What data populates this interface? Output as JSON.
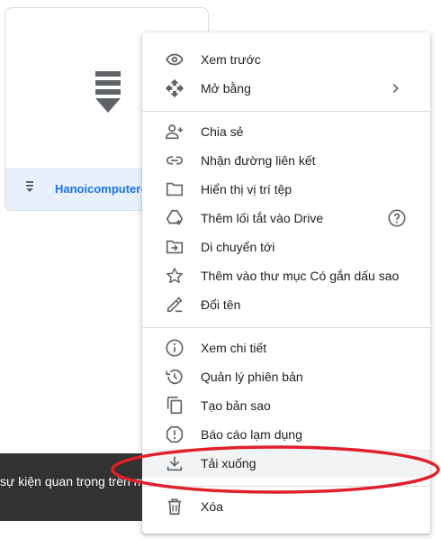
{
  "file": {
    "name": "Hanoicomputer-A"
  },
  "snackbar": {
    "text": "sự kiện quan trọng trên m"
  },
  "menu": {
    "preview": "Xem trước",
    "open_with": "Mở bằng",
    "share": "Chia sẻ",
    "get_link": "Nhận đường liên kết",
    "show_location": "Hiển thị vị trí tệp",
    "add_shortcut": "Thêm lối tắt vào Drive",
    "move_to": "Di chuyển tới",
    "add_starred": "Thêm vào thư mục Có gắn dấu sao",
    "rename": "Đổi tên",
    "view_details": "Xem chi tiết",
    "manage_versions": "Quản lý phiên bản",
    "make_copy": "Tạo bản sao",
    "report_abuse": "Báo cáo lạm dụng",
    "download": "Tải xuống",
    "delete": "Xóa"
  },
  "colors": {
    "icon": "#5f6368",
    "accent": "#1a73e8",
    "annotation": "#e0202a"
  },
  "icons": {
    "preview": "eye-icon",
    "open_with": "move-arrows-icon",
    "share": "add-person-icon",
    "get_link": "link-icon",
    "show_location": "folder-icon",
    "add_shortcut": "drive-shortcut-icon",
    "move_to": "move-to-folder-icon",
    "add_starred": "star-icon",
    "rename": "pencil-icon",
    "view_details": "info-icon",
    "manage_versions": "history-icon",
    "make_copy": "copy-icon",
    "report_abuse": "report-icon",
    "download": "download-icon",
    "delete": "trash-icon"
  }
}
